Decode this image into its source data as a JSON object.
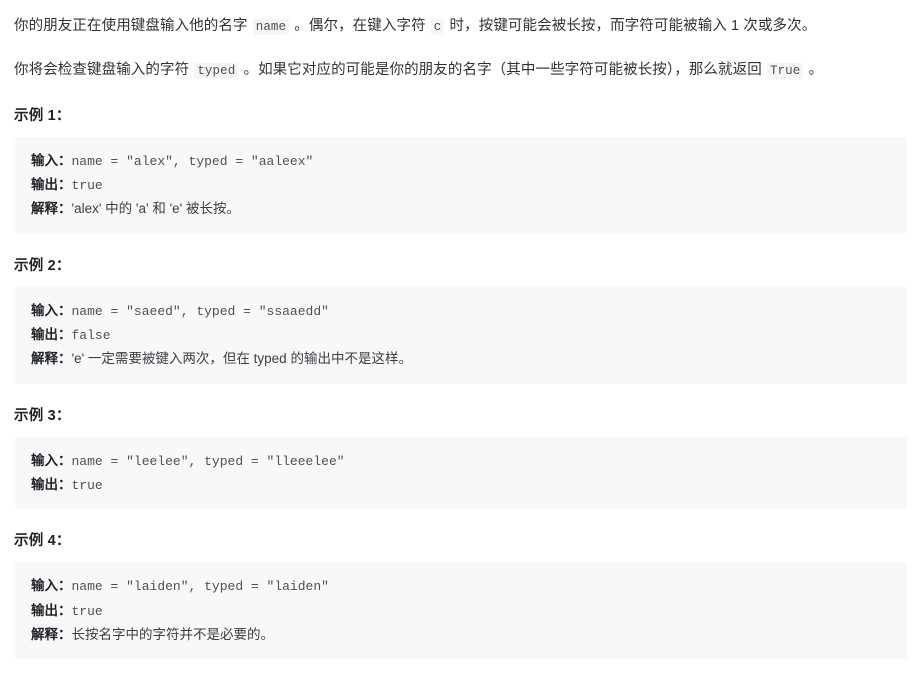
{
  "document": {
    "intro": [
      {
        "id": "intro-paragraph-1",
        "segments": [
          {
            "type": "text",
            "value": "你的朋友正在使用键盘输入他的名字 "
          },
          {
            "type": "code",
            "value": "name"
          },
          {
            "type": "text",
            "value": " 。偶尔，在键入字符 "
          },
          {
            "type": "code",
            "value": "c"
          },
          {
            "type": "text",
            "value": " 时，按键可能会被长按，而字符可能被输入 1 次或多次。"
          }
        ]
      },
      {
        "id": "intro-paragraph-2",
        "segments": [
          {
            "type": "text",
            "value": "你将会检查键盘输入的字符 "
          },
          {
            "type": "code",
            "value": "typed"
          },
          {
            "type": "text",
            "value": " 。如果它对应的可能是你的朋友的名字（其中一些字符可能被长按），那么就返回 "
          },
          {
            "type": "code",
            "value": "True"
          },
          {
            "type": "text",
            "value": " 。"
          }
        ]
      }
    ],
    "examples": [
      {
        "heading": "示例 1：",
        "lines": [
          {
            "label": "输入：",
            "code": "name = \"alex\", typed = \"aaleex\"",
            "cjk": ""
          },
          {
            "label": "输出：",
            "code": "true",
            "cjk": ""
          },
          {
            "label": "解释：",
            "code": "",
            "cjk": "'alex' 中的 'a' 和 'e' 被长按。"
          }
        ]
      },
      {
        "heading": "示例 2：",
        "lines": [
          {
            "label": "输入：",
            "code": "name = \"saeed\", typed = \"ssaaedd\"",
            "cjk": ""
          },
          {
            "label": "输出：",
            "code": "false",
            "cjk": ""
          },
          {
            "label": "解释：",
            "code": "",
            "cjk": "'e' 一定需要被键入两次，但在 typed 的输出中不是这样。"
          }
        ]
      },
      {
        "heading": "示例 3：",
        "lines": [
          {
            "label": "输入：",
            "code": "name = \"leelee\", typed = \"lleeelee\"",
            "cjk": ""
          },
          {
            "label": "输出：",
            "code": "true",
            "cjk": ""
          }
        ]
      },
      {
        "heading": "示例 4：",
        "lines": [
          {
            "label": "输入：",
            "code": "name = \"laiden\", typed = \"laiden\"",
            "cjk": ""
          },
          {
            "label": "输出：",
            "code": "true",
            "cjk": ""
          },
          {
            "label": "解释：",
            "code": "",
            "cjk": "长按名字中的字符并不是必要的。"
          }
        ]
      }
    ],
    "colors": {
      "code_block_background": "#f8f8f9",
      "inline_code_background": "#f5f5f6",
      "body_text": "#2f3235",
      "code_text": "#4b5156",
      "heading_text": "#1f2328"
    }
  }
}
